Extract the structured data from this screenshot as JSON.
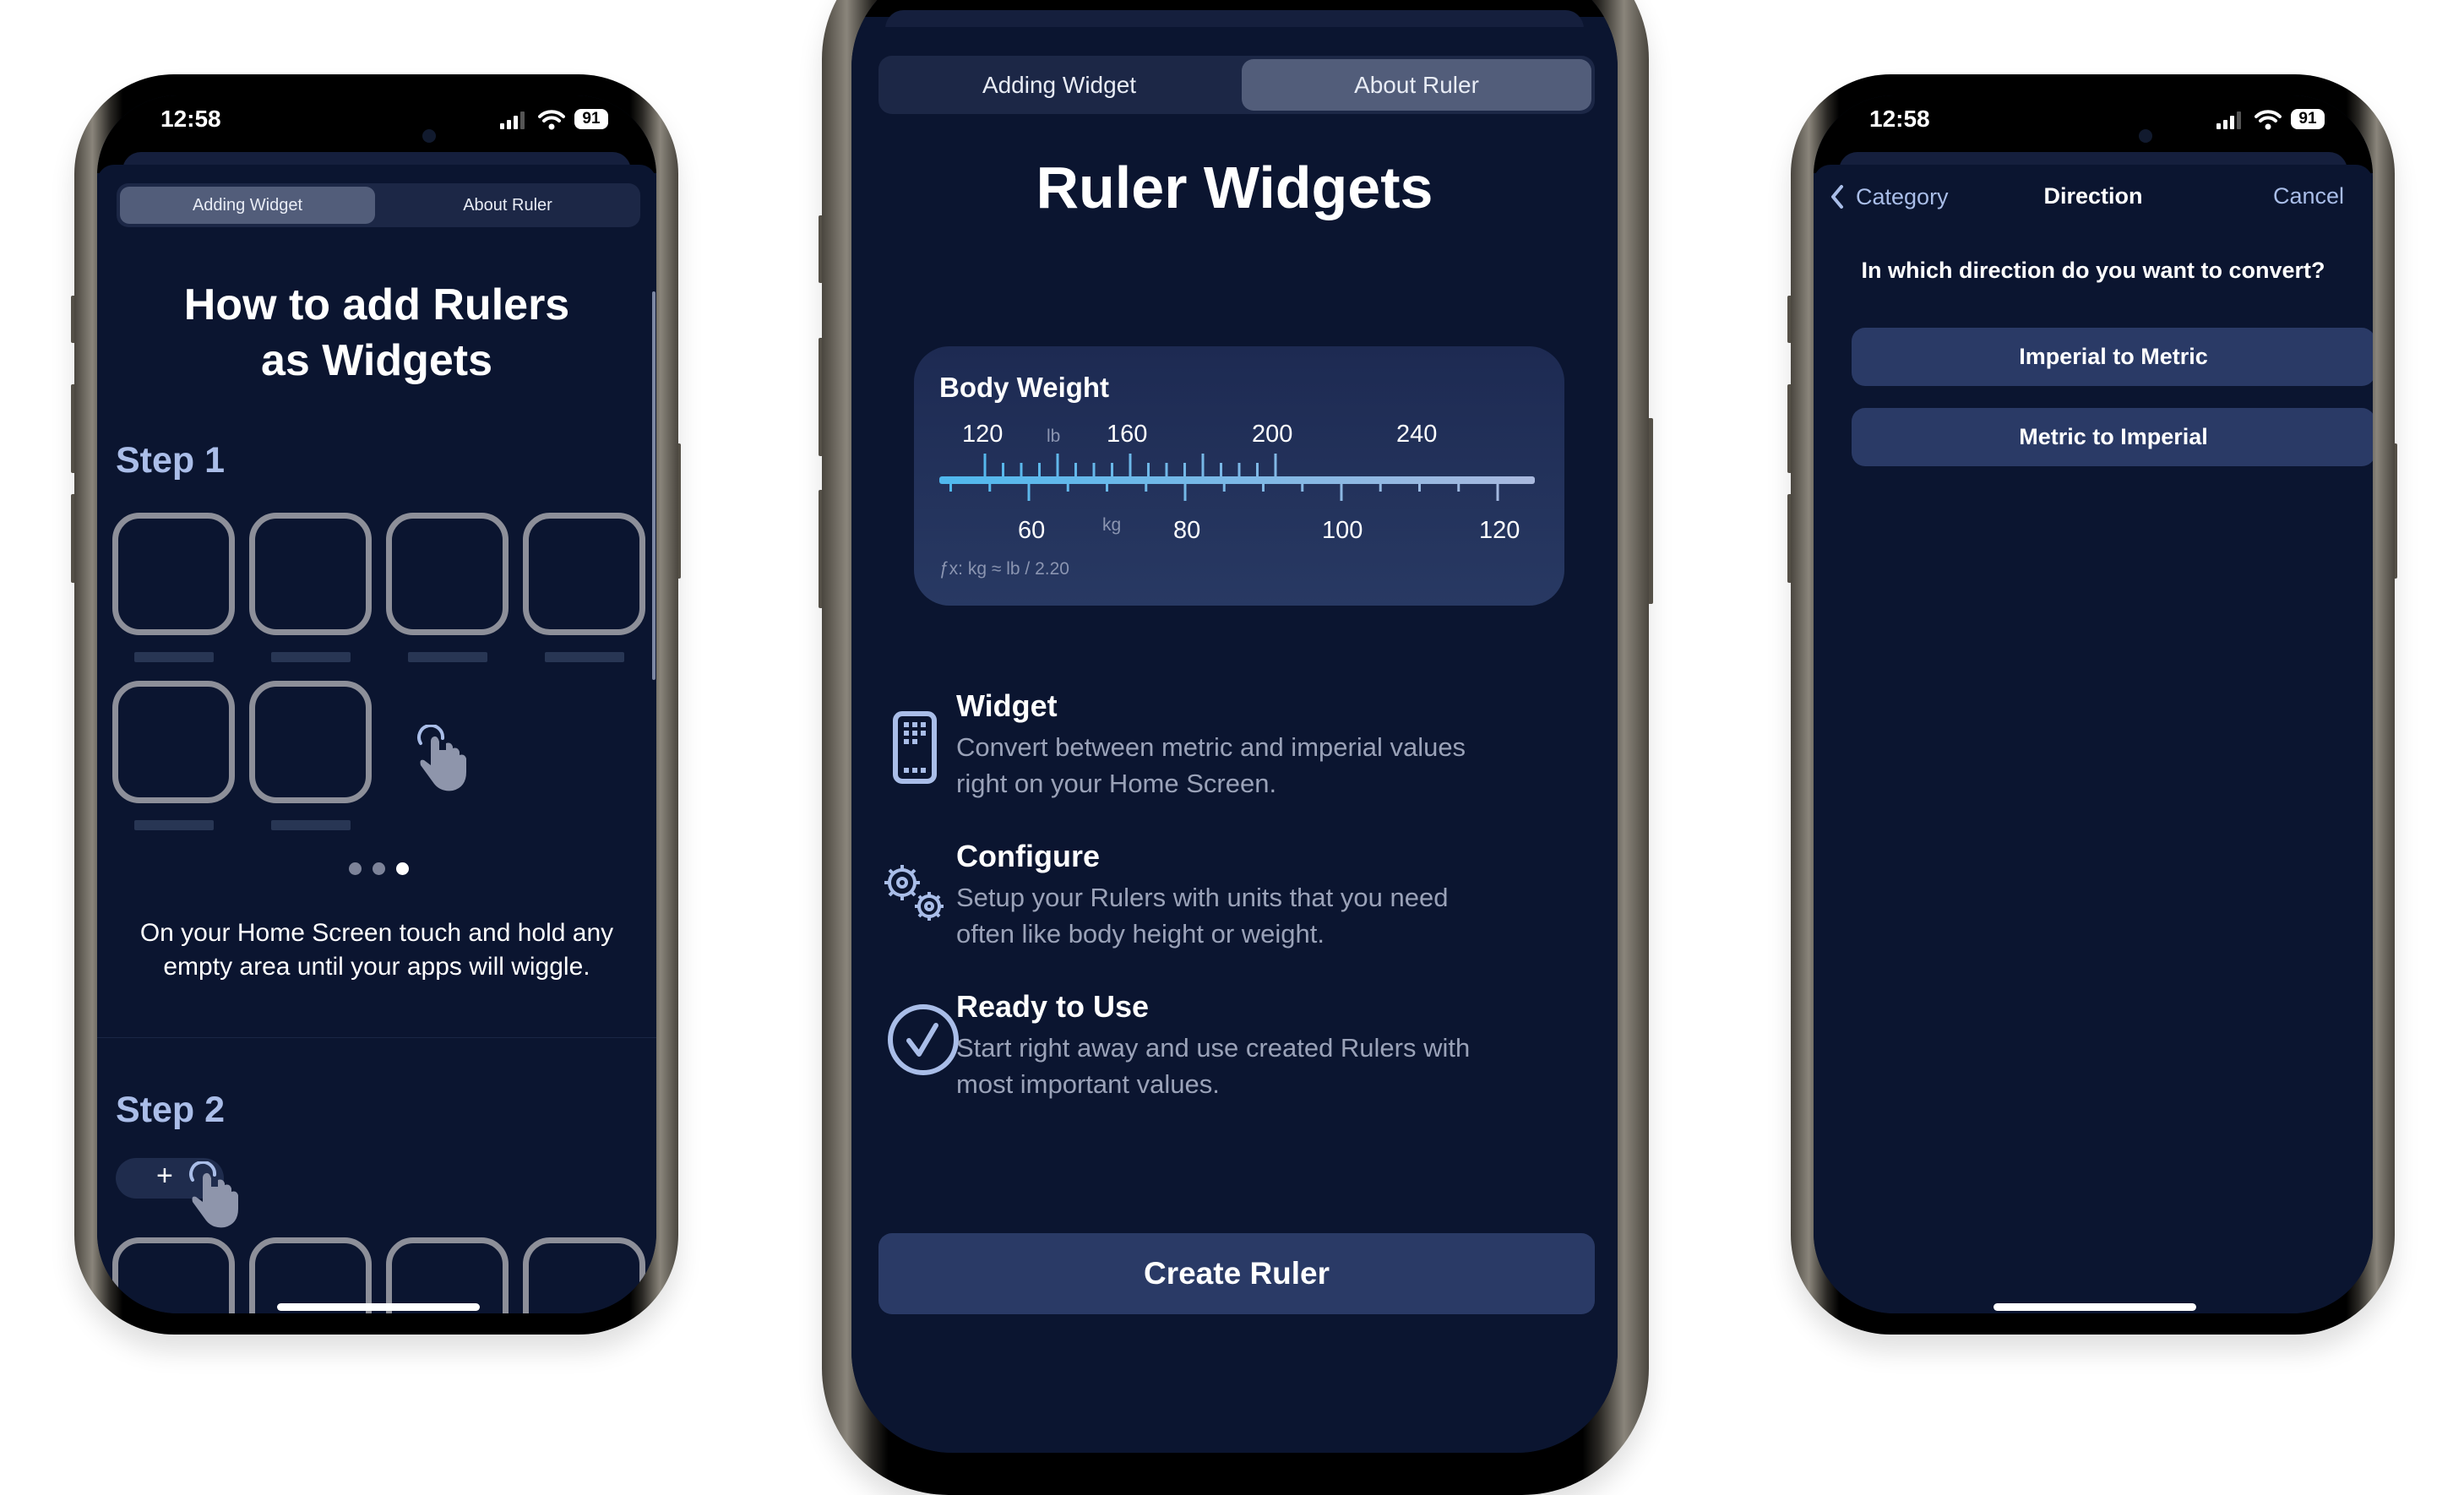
{
  "status_bar": {
    "time": "12:58",
    "battery": "91"
  },
  "colors": {
    "screen_bg": "#0b1530",
    "segment_bg": "#1c2746",
    "segment_active": "#525d7a",
    "button_bg": "#2a3a66",
    "accent_light_blue": "#aabde8",
    "ruler_start": "#4fb8ee",
    "ruler_end": "#a9b8de"
  },
  "left_phone": {
    "tabs": [
      {
        "label": "Adding Widget",
        "active": true
      },
      {
        "label": "About Ruler",
        "active": false
      }
    ],
    "title_line1": "How to add Rulers",
    "title_line2": "as Widgets",
    "step1": {
      "heading": "Step 1",
      "app_placeholders": 6,
      "icon": "tap-hand-icon",
      "pagination": {
        "count": 3,
        "active_index": 2
      },
      "description_line1": "On your Home Screen touch and hold any",
      "description_line2": "empty area until your apps will wiggle."
    },
    "step2": {
      "heading": "Step 2",
      "add_button_label": "+",
      "icon": "tap-hand-icon"
    }
  },
  "middle_phone": {
    "tabs": [
      {
        "label": "Adding Widget",
        "active": false
      },
      {
        "label": "About Ruler",
        "active": true
      }
    ],
    "title": "Ruler Widgets",
    "ruler_card": {
      "title": "Body Weight",
      "top_unit": "lb",
      "bottom_unit": "kg",
      "top_labels": [
        "120",
        "160",
        "200",
        "240"
      ],
      "bottom_labels": [
        "60",
        "80",
        "100",
        "120"
      ],
      "formula": "ƒx: kg ≈ lb / 2.20"
    },
    "features": [
      {
        "icon": "widget-phone-icon",
        "title": "Widget",
        "line1": "Convert between metric and imperial values",
        "line2": "right on your Home Screen."
      },
      {
        "icon": "gears-icon",
        "title": "Configure",
        "line1": "Setup your Rulers with units that you need",
        "line2": "often like body height or weight."
      },
      {
        "icon": "checkmark-circle-icon",
        "title": "Ready to Use",
        "line1": "Start right away and use created Rulers with",
        "line2": "most important values."
      }
    ],
    "create_button": "Create Ruler"
  },
  "right_phone": {
    "nav": {
      "back_label": "Category",
      "title": "Direction",
      "cancel_label": "Cancel"
    },
    "question": "In which direction do you want to convert?",
    "options": [
      "Imperial to Metric",
      "Metric to Imperial"
    ]
  }
}
